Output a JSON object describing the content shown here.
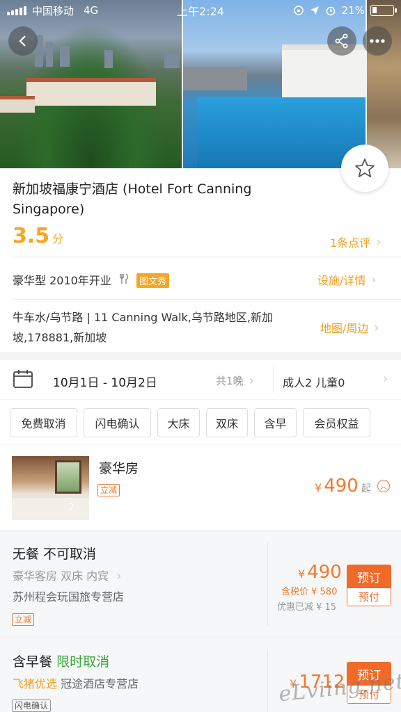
{
  "status_bar": {
    "carrier": "中国移动",
    "network": "4G",
    "time": "上午2:24",
    "battery": "21%",
    "battery_level": 0.21
  },
  "hotel": {
    "name": "新加坡福康宁酒店 (Hotel Fort Canning Singapore)",
    "rating": "3.5",
    "rating_unit": "分",
    "reviews_link": "1条点评",
    "category": "豪华型 2010年开业",
    "feature_tag": "图文秀",
    "facilities_link": "设施/详情",
    "address": "牛车水/乌节路 | 11 Canning Walk,乌节路地区,新加坡,178881,新加坡",
    "map_link": "地图/周边"
  },
  "stay": {
    "dates": "10月1日 - 10月2日",
    "nights": "共1晚",
    "guests": "成人2 儿童0"
  },
  "filters": [
    "免费取消",
    "闪电确认",
    "大床",
    "双床",
    "含早",
    "会员权益"
  ],
  "room": {
    "title": "豪华房",
    "tag": "立减",
    "photo_count": "2",
    "currency": "¥",
    "price": "490",
    "price_suffix": "起"
  },
  "plans": [
    {
      "title": "无餐 不可取消",
      "details": "豪华客房 双床 内宾",
      "vendor": "苏州程会玩国旅专营店",
      "tag": "立减",
      "currency": "¥",
      "price": "490",
      "tax_price": "含税价 ¥ 580",
      "saved": "优惠已减 ¥ 15",
      "book_label": "预订",
      "pay_label": "预付"
    },
    {
      "title_main": "含早餐",
      "title_highlight": "限时取消",
      "vendor_brand": "飞猪优选",
      "vendor": "冠途酒店专营店",
      "tag": "闪电确认",
      "currency": "¥",
      "price": "1712",
      "book_label": "预订",
      "pay_label": "预付"
    }
  ],
  "watermark": "eLviing.net",
  "colors": {
    "accent_orange": "#f07a2c",
    "rating_yellow": "#f5a623",
    "book_button": "#f06a2a",
    "green": "#3aa43a"
  },
  "icons": {
    "back": "chevron-left-icon",
    "share": "share-icon",
    "more": "more-icon",
    "favorite": "star-icon",
    "calendar": "calendar-icon",
    "restaurant": "fork-knife-icon"
  }
}
